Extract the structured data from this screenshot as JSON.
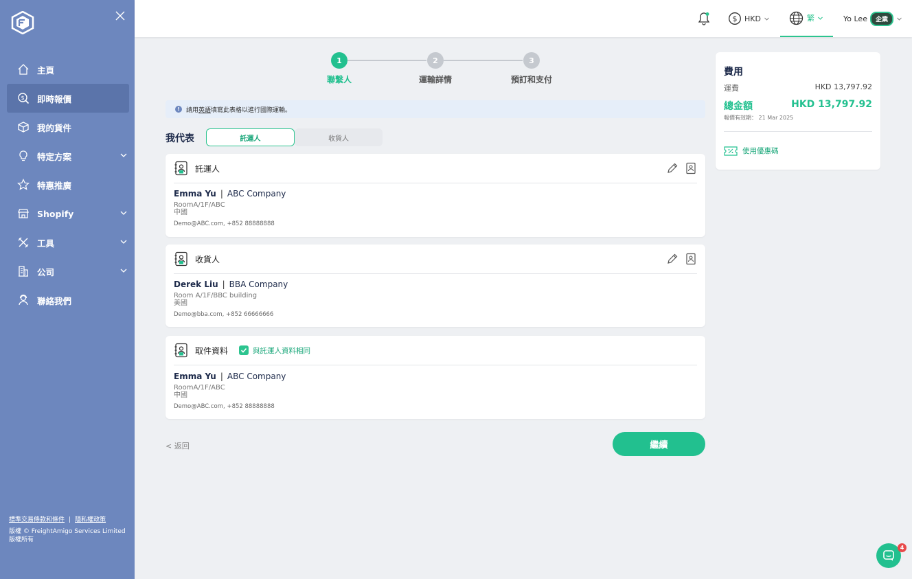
{
  "sidebar": {
    "logo": "freightamigo-logo",
    "items": [
      {
        "label": "主頁",
        "icon": "home-icon"
      },
      {
        "label": "即時報價",
        "icon": "dollar-search-icon",
        "active": true
      },
      {
        "label": "我的貨件",
        "icon": "box-icon"
      },
      {
        "label": "特定方案",
        "icon": "lightbulb-icon",
        "expandable": true
      },
      {
        "label": "特惠推廣",
        "icon": "star-icon"
      },
      {
        "label": "Shopify",
        "icon": "store-icon",
        "expandable": true
      },
      {
        "label": "工具",
        "icon": "tools-icon",
        "expandable": true
      },
      {
        "label": "公司",
        "icon": "building-icon",
        "expandable": true
      },
      {
        "label": "聯絡我們",
        "icon": "support-icon"
      }
    ],
    "footer": {
      "terms": "標準交易條款和條件",
      "separator": "|",
      "privacy": "隱私權政策",
      "copyright": "版權 © FreightAmigo Services Limited",
      "rights": "版權所有"
    }
  },
  "topbar": {
    "currency": "HKD",
    "language": "繁",
    "user": "Yo Lee",
    "user_badge": "企業"
  },
  "stepper": [
    {
      "num": "1",
      "label": "聯繫人",
      "state": "active"
    },
    {
      "num": "2",
      "label": "運輸詳情",
      "state": "pending"
    },
    {
      "num": "3",
      "label": "預訂和支付",
      "state": "pending"
    }
  ],
  "notice": {
    "prefix": "請用",
    "emph": "英語",
    "suffix": "填寫此表格以進行國際運輸。"
  },
  "represent": {
    "label": "我代表",
    "options": [
      "託運人",
      "收貨人"
    ]
  },
  "cards": {
    "shipper": {
      "title": "託運人",
      "name": "Emma Yu",
      "company": "ABC Company",
      "addr1": "RoomA/1F/ABC",
      "addr2": "中國",
      "contact": "Demo@ABC.com,   +852 88888888"
    },
    "consignee": {
      "title": "收貨人",
      "name": "Derek Liu",
      "company": "BBA Company",
      "addr1": "Room A/1F/BBC building",
      "addr2": "美國",
      "contact": "Demo@bba.com,   +852 66666666"
    },
    "pickup": {
      "title": "取件資料",
      "same_label": "與託運人資料相同",
      "name": "Emma Yu",
      "company": "ABC Company",
      "addr1": "RoomA/1F/ABC",
      "addr2": "中國",
      "contact": "Demo@ABC.com,   +852 88888888"
    }
  },
  "actions": {
    "back": "< 返回",
    "continue": "繼續"
  },
  "fee": {
    "title": "費用",
    "freight_label": "運費",
    "freight_amount": "HKD 13,797.92",
    "total_label": "總金額",
    "total_amount": "HKD 13,797.92",
    "validity": "報價有效期：  21 Mar 2025",
    "coupon": "使用優惠碼"
  },
  "chat": {
    "badge": "4"
  },
  "colors": {
    "accent": "#22c08f",
    "sidebar": "#6d87be",
    "navy": "#1d2a4a"
  }
}
